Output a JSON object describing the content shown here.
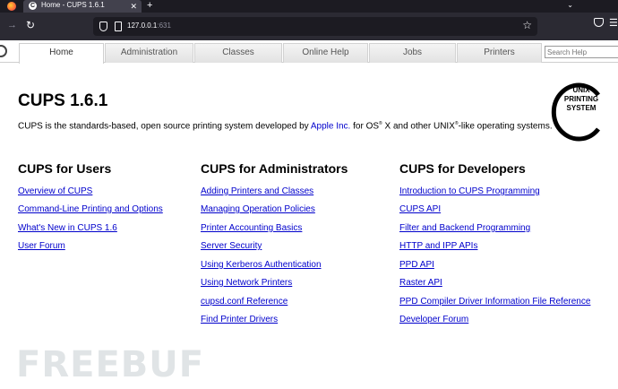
{
  "browser": {
    "tab_title": "Home - CUPS 1.6.1",
    "tab_close": "✕",
    "new_tab": "+",
    "overflow": "⌄",
    "url_host": "127.0.0.1",
    "url_port": ":631",
    "favicon_letter": "C",
    "forward_icon": "→",
    "reload_icon": "↻",
    "star_icon": "☆",
    "menu_icon": "☰"
  },
  "nav": {
    "tabs": [
      "Home",
      "Administration",
      "Classes",
      "Online Help",
      "Jobs",
      "Printers"
    ],
    "active": "Home",
    "search_placeholder": "Search Help"
  },
  "main": {
    "title": "CUPS 1.6.1",
    "intro_before": "CUPS is the standards-based, open source printing system developed by ",
    "intro_link": "Apple Inc.",
    "intro_mid": " for OS",
    "intro_after_os": " X and other UNIX",
    "intro_end": "-like operating systems.",
    "sup_mark": "®"
  },
  "logo": {
    "line1": "UNIX",
    "line2": "PRINTING",
    "line3": "SYSTEM"
  },
  "columns": [
    {
      "heading": "CUPS for Users",
      "links": [
        "Overview of CUPS",
        "Command-Line Printing and Options",
        "What's New in CUPS 1.6",
        "User Forum"
      ]
    },
    {
      "heading": "CUPS for Administrators",
      "links": [
        "Adding Printers and Classes",
        "Managing Operation Policies",
        "Printer Accounting Basics",
        "Server Security",
        "Using Kerberos Authentication",
        "Using Network Printers",
        "cupsd.conf Reference",
        "Find Printer Drivers"
      ]
    },
    {
      "heading": "CUPS for Developers",
      "links": [
        "Introduction to CUPS Programming",
        "CUPS API",
        "Filter and Backend Programming",
        "HTTP and IPP APIs",
        "PPD API",
        "Raster API",
        "PPD Compiler Driver Information File Reference",
        "Developer Forum"
      ]
    }
  ],
  "watermark": "FREEBUF",
  "colors": {
    "link": "#0000cc",
    "chrome_dark": "#1c1b22",
    "chrome_bar": "#2b2a33"
  }
}
